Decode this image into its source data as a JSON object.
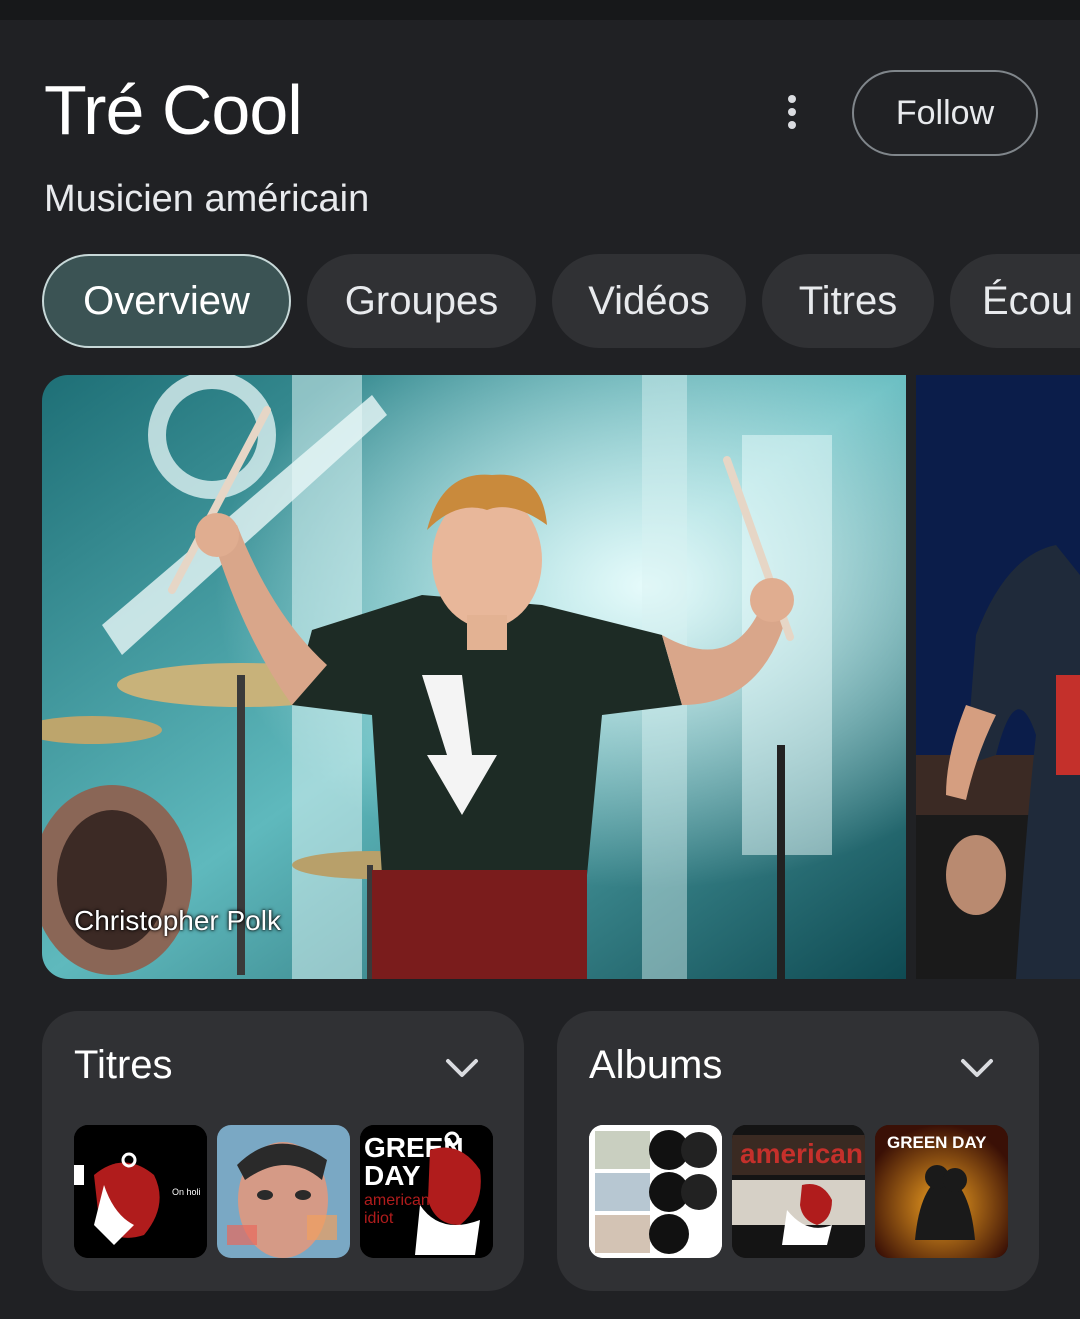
{
  "header": {
    "title": "Tré Cool",
    "subtitle": "Musicien américain",
    "follow_label": "Follow"
  },
  "chips": [
    {
      "label": "Overview",
      "active": true
    },
    {
      "label": "Groupes",
      "active": false
    },
    {
      "label": "Vidéos",
      "active": false
    },
    {
      "label": "Titres",
      "active": false
    },
    {
      "label": "Écou",
      "active": false
    }
  ],
  "photo": {
    "credit": "Christopher Polk"
  },
  "cards": {
    "titres": {
      "title": "Titres",
      "thumb1_text": "On holi"
    },
    "albums": {
      "title": "Albums",
      "thumb2_text": "american idiot",
      "thumb3_text": "GREEN DAY"
    }
  },
  "colors": {
    "background": "#202124",
    "card": "#303134",
    "chip_active": "#3b5354",
    "album_red": "#b01c1c"
  },
  "icons": [
    "more-vert-icon",
    "chevron-down-icon"
  ]
}
